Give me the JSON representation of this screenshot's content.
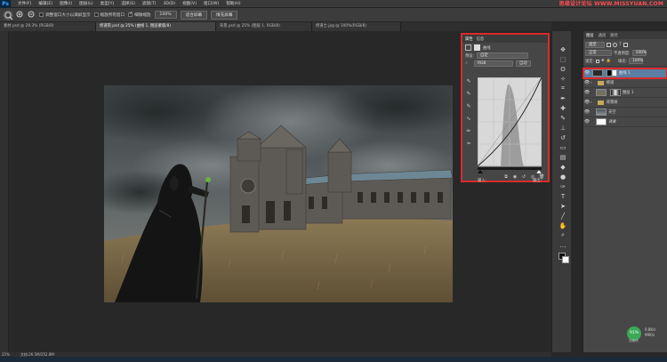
{
  "app": {
    "logo": "Ps"
  },
  "menu": [
    "文件(F)",
    "编辑(E)",
    "图像(I)",
    "图层(L)",
    "类型(Y)",
    "选择(S)",
    "滤镜(T)",
    "3D(D)",
    "视图(V)",
    "窗口(W)",
    "帮助(H)"
  ],
  "watermark": "思缘设计论坛 WWW.MISSYUAN.COM",
  "options": {
    "resize_window": "调整窗口大小以满屏显示",
    "zoom_all": "缩放所有窗口",
    "scrubby_zoom": "细微缩放",
    "zoom_100": "100%",
    "fit_screen": "适合屏幕",
    "fill_screen": "填充屏幕"
  },
  "tabs": [
    "素材.psd @ 29.3% (RGB/8)",
    "修道院.psd @ 25% (曲线 1, 图层蒙版/8)",
    "背景.psd @ 25% (图层 1, RGB/8)",
    "修道士.jpg @ 100%(RGB/8)"
  ],
  "curves": {
    "tab_properties": "属性",
    "tab_info": "信息",
    "title": "曲线",
    "preset_label": "预设:",
    "preset_value": "自定",
    "channel_value": "RGB",
    "auto_button": "自动",
    "input_label": "输入:",
    "output_label": "输出:"
  },
  "layers": {
    "tab_layers": "图层",
    "tab_channels": "通道",
    "tab_paths": "路径",
    "kind_label": "类型",
    "blend_mode": "正常",
    "opacity_label": "不透明度:",
    "opacity_value": "100%",
    "lock_label": "锁定:",
    "fill_label": "填充:",
    "fill_value": "100%",
    "items": [
      {
        "name": "曲线 1",
        "kind": "adjustment",
        "selected": true
      },
      {
        "name": "修道",
        "kind": "group",
        "selected": false
      },
      {
        "name": "图层 1",
        "kind": "image",
        "selected": false
      },
      {
        "name": "背景树",
        "kind": "group",
        "selected": false
      },
      {
        "name": "天空",
        "kind": "image",
        "selected": false
      },
      {
        "name": "背景",
        "kind": "image",
        "selected": false
      }
    ]
  },
  "status": {
    "zoom": "25%",
    "doc_size": "文档:26.5M/252.8M"
  },
  "speed": {
    "percent": "91%",
    "up": "0.8K/s",
    "down": "99K/s",
    "accelerate": "加速球"
  },
  "colors": {
    "accent_red": "#d92b2b",
    "selection_blue": "#5b7ea3",
    "panel": "#474747"
  }
}
